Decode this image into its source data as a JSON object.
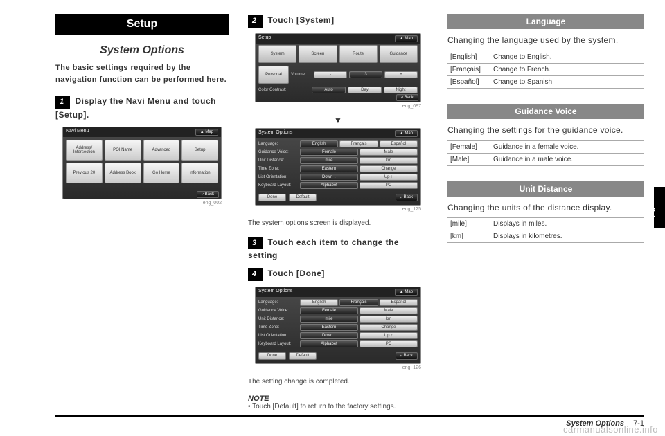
{
  "header": {
    "setup": "Setup"
  },
  "col1": {
    "title": "System Options",
    "intro": "The basic settings required by the navigation function can be performed here.",
    "step1_num": "1",
    "step1_text": "Display the Navi Menu and touch [Setup].",
    "ss1": {
      "title": "Navi Menu",
      "map": "▲ Map",
      "btns": [
        "Address/\nIntersection",
        "POI Name",
        "Advanced",
        "Setup",
        "Previous\n20",
        "Address\nBook",
        "Go Home",
        "Information"
      ],
      "back": "⤶ Back"
    },
    "caption1": "eng_002"
  },
  "col2": {
    "step2_num": "2",
    "step2_text": "Touch [System]",
    "ss2": {
      "title": "Setup",
      "map": "▲ Map",
      "topbtns": [
        "System",
        "Screen",
        "Route",
        "Guidance"
      ],
      "personal": "Personal",
      "vol_label": "Volume:",
      "vol_minus": "-",
      "vol_val": "3",
      "vol_plus": "+",
      "cc_label": "Color Contrast:",
      "cc_opts": [
        "Auto",
        "Day",
        "Night"
      ],
      "back": "⤶ Back"
    },
    "caption2": "eng_097",
    "ss3": {
      "title": "System Options",
      "map": "▲ Map",
      "rows": [
        {
          "label": "Language:",
          "opts": [
            "English",
            "Français",
            "Español"
          ],
          "sel": 0
        },
        {
          "label": "Guidance Voice:",
          "opts": [
            "Female",
            "Male"
          ],
          "sel": 0
        },
        {
          "label": "Unit Distance:",
          "opts": [
            "mile",
            "km"
          ],
          "sel": 0
        },
        {
          "label": "Time Zone:",
          "opts": [
            "Eastern",
            "Change"
          ],
          "sel": 0
        },
        {
          "label": "List Orientation:",
          "opts": [
            "Down ↓",
            "Up ↑"
          ],
          "sel": 0
        },
        {
          "label": "Keyboard Layout:",
          "opts": [
            "Alphabet",
            "PC"
          ],
          "sel": 0
        }
      ],
      "done": "Done",
      "default": "Default",
      "back": "⤶ Back"
    },
    "caption3": "eng_125",
    "after_ss3": "The system options screen is displayed.",
    "step3_num": "3",
    "step3_text": "Touch each item to change the setting",
    "step4_num": "4",
    "step4_text": "Touch [Done]",
    "ss4_caption": "eng_126",
    "after_ss4": "The setting change is completed.",
    "note_label": "NOTE",
    "note_text": "• Touch [Default] to return to the factory settings."
  },
  "col3": {
    "lang": {
      "head": "Language",
      "desc": "Changing the language used by the system.",
      "rows": [
        [
          "[English]",
          "Change to English."
        ],
        [
          "[Français]",
          "Change to French."
        ],
        [
          "[Español]",
          "Change to Spanish."
        ]
      ]
    },
    "voice": {
      "head": "Guidance Voice",
      "desc": "Changing the settings for the guidance voice.",
      "rows": [
        [
          "[Female]",
          "Guidance in a female voice."
        ],
        [
          "[Male]",
          "Guidance in a male voice."
        ]
      ]
    },
    "unit": {
      "head": "Unit Distance",
      "desc": "Changing the units of the distance display.",
      "rows": [
        [
          "[mile]",
          "Displays in miles."
        ],
        [
          "[km]",
          "Displays in kilometres."
        ]
      ]
    }
  },
  "side_tab": "Setup",
  "footer": {
    "name": "System Options",
    "page": "7-1"
  },
  "watermark": "carmanualsonline.info"
}
